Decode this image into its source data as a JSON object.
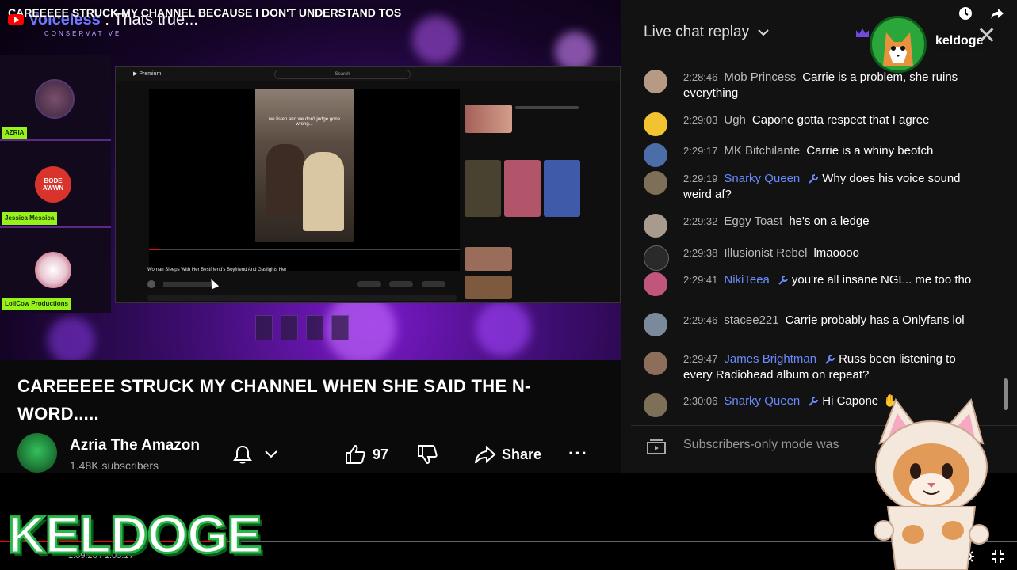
{
  "window": {
    "overlay_title": "CAREEEEE STRUCK MY CHANNEL BECAUSE I DON'T UNDERSTAND TOS",
    "stream_channel": "Voiceless",
    "stream_sub_tag": "CONSERVATIVE",
    "stream_caption": " : Thats true..."
  },
  "video": {
    "title": "CAREEEEE STRUCK MY CHANNEL WHEN SHE SAID THE N-WORD.....",
    "channel_name": "Azria The Amazon",
    "subscribers": "1.48K subscribers",
    "likes": "97",
    "share_label": "Share",
    "more_label": "···",
    "inner_caption": "we listen and we don't judge gone wrong...",
    "left_labels": [
      "AZRIA",
      "Jessica Messica",
      "LoliCow Productions"
    ],
    "bode_badge_text": "BODE AWWN"
  },
  "chat": {
    "header": "Live chat replay",
    "keldoge_name": "keldoge",
    "messages": [
      {
        "time": "2:28:46",
        "author": "Mob Princess",
        "mod": false,
        "text": "Carrie is a problem, she ruins everything",
        "avatar_color": "#b79a83"
      },
      {
        "time": "2:29:03",
        "author": "Ugh",
        "mod": false,
        "text": "Capone gotta respect that I agree",
        "avatar_color": "#f2c230"
      },
      {
        "time": "2:29:17",
        "author": "MK Bitchilante",
        "mod": false,
        "text": "Carrie is a whiny beotch",
        "avatar_color": "#4b6ea8"
      },
      {
        "time": "2:29:19",
        "author": "Snarky Queen",
        "mod": true,
        "text": "Why does his voice sound weird af?",
        "avatar_color": "#7d6f58"
      },
      {
        "time": "2:29:32",
        "author": "Eggy Toast",
        "mod": false,
        "text": "he's on a ledge",
        "avatar_color": "#a89a8c"
      },
      {
        "time": "2:29:38",
        "author": "Illusionist Rebel",
        "mod": false,
        "text": "lmaoooo",
        "avatar_color": "#2a2a2a"
      },
      {
        "time": "2:29:41",
        "author": "NikiTeea",
        "mod": true,
        "text": "you're all insane NGL.. me too tho",
        "avatar_color": "#c0567c"
      },
      {
        "time": "2:29:46",
        "author": "stacee221",
        "mod": false,
        "text": "Carrie probably has a Onlyfans lol",
        "avatar_color": "#7a8a9a"
      },
      {
        "time": "2:29:47",
        "author": "James Brightman",
        "mod": true,
        "text": "Russ been listening to every Radiohead album on repeat?",
        "avatar_color": "#8d6e5a"
      },
      {
        "time": "2:30:06",
        "author": "Snarky Queen",
        "mod": true,
        "text": "Hi Capone",
        "avatar_color": "#7d6f58"
      }
    ],
    "subscribers_mode": "Subscribers-only mode was"
  },
  "player": {
    "time": "1:09:26 / 1:03:17",
    "logo_text": "KELDOGE",
    "progress_fraction": 0.22
  },
  "colors": {
    "mod_blue": "#6a8bff",
    "brand_green": "#2ab84a",
    "progress_red": "#ff0000"
  }
}
